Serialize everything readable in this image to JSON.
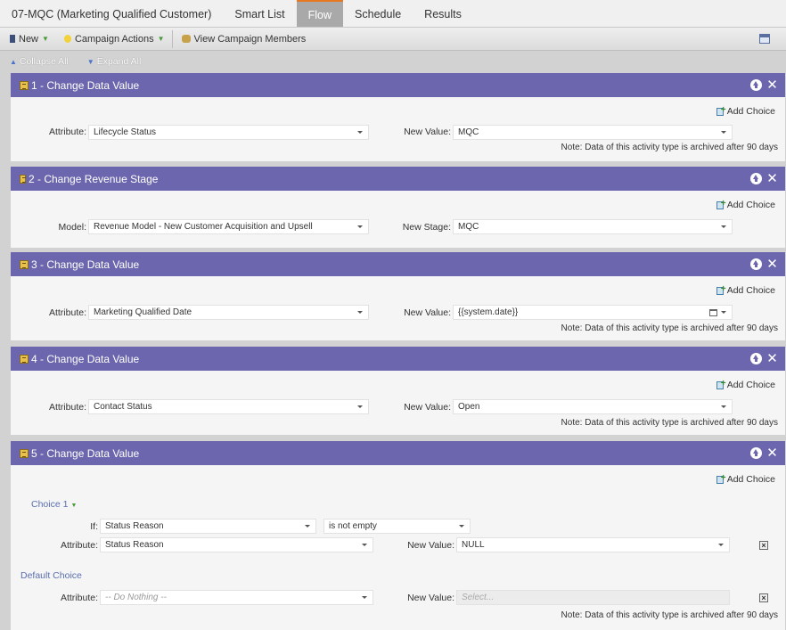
{
  "tabs": {
    "program_title": "07-MQC (Marketing Qualified Customer)",
    "items": [
      {
        "label": "Smart List"
      },
      {
        "label": "Flow"
      },
      {
        "label": "Schedule"
      },
      {
        "label": "Results"
      }
    ],
    "active": "Flow"
  },
  "toolbar": {
    "new_label": "New",
    "campaign_actions_label": "Campaign Actions",
    "view_members_label": "View Campaign Members"
  },
  "collapse": {
    "collapse_all": "Collapse All",
    "expand_all": "Expand All"
  },
  "common": {
    "add_choice": "Add Choice",
    "note": "Note: Data of this activity type is archived after 90 days"
  },
  "steps": [
    {
      "title": "1 - Change Data Value",
      "field1_label": "Attribute:",
      "field1_value": "Lifecycle Status",
      "field2_label": "New Value:",
      "field2_value": "MQC"
    },
    {
      "title": "2 - Change Revenue Stage",
      "field1_label": "Model:",
      "field1_value": "Revenue Model - New Customer Acquisition and Upsell",
      "field2_label": "New Stage:",
      "field2_value": "MQC"
    },
    {
      "title": "3 - Change Data Value",
      "field1_label": "Attribute:",
      "field1_value": "Marketing Qualified Date",
      "field2_label": "New Value:",
      "field2_value": "{{system.date}}"
    },
    {
      "title": "4 - Change Data Value",
      "field1_label": "Attribute:",
      "field1_value": "Contact Status",
      "field2_label": "New Value:",
      "field2_value": "Open"
    },
    {
      "title": "5 - Change Data Value",
      "choice1_label": "Choice 1",
      "if_label": "If:",
      "if_field": "Status Reason",
      "if_operator": "is not empty",
      "choice_attr_label": "Attribute:",
      "choice_attr_value": "Status Reason",
      "choice_new_label": "New Value:",
      "choice_new_value": "NULL",
      "default_label": "Default Choice",
      "default_attr_label": "Attribute:",
      "default_attr_value": "-- Do Nothing --",
      "default_new_label": "New Value:",
      "default_new_placeholder": "Select..."
    }
  ],
  "colors": {
    "step_header": "#6b66ad",
    "active_tab": "#a9a9a9",
    "active_tab_accent": "#e87722"
  }
}
